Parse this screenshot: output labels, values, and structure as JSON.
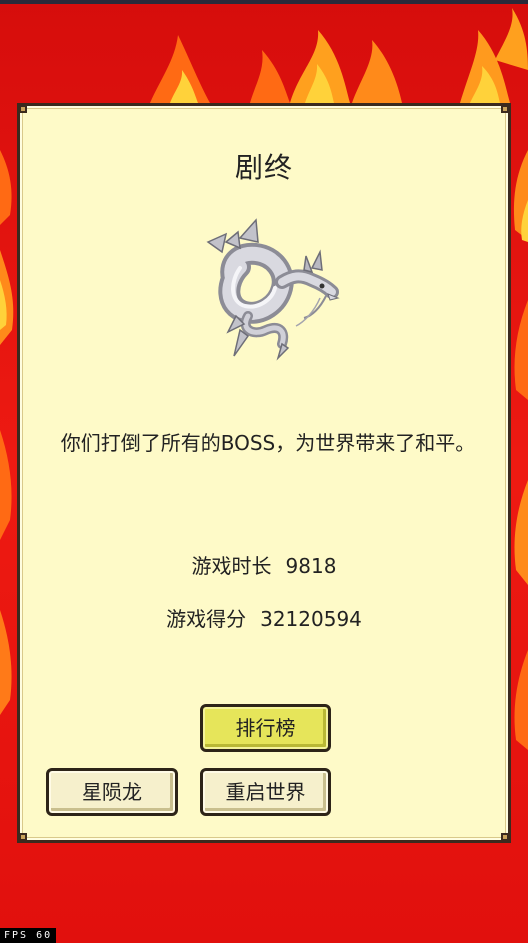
{
  "screen": {
    "title": "剧终",
    "message": "你们打倒了所有的BOSS，为世界带来了和平。",
    "stats": {
      "time_label": "游戏时长",
      "time_value": "9818",
      "score_label": "游戏得分",
      "score_value": "32120594"
    },
    "buttons": {
      "leaderboard": "排行榜",
      "character": "星陨龙",
      "restart": "重启世界"
    },
    "boss_icon": "silver-dragon-icon"
  },
  "debug": {
    "fps_label": "FPS",
    "fps_value": "60"
  },
  "colors": {
    "background_red": "#e8140f",
    "flame_orange": "#ff8a1a",
    "panel": "#fefac8",
    "button_primary": "#e6e55a",
    "button": "#f6f0cc"
  }
}
